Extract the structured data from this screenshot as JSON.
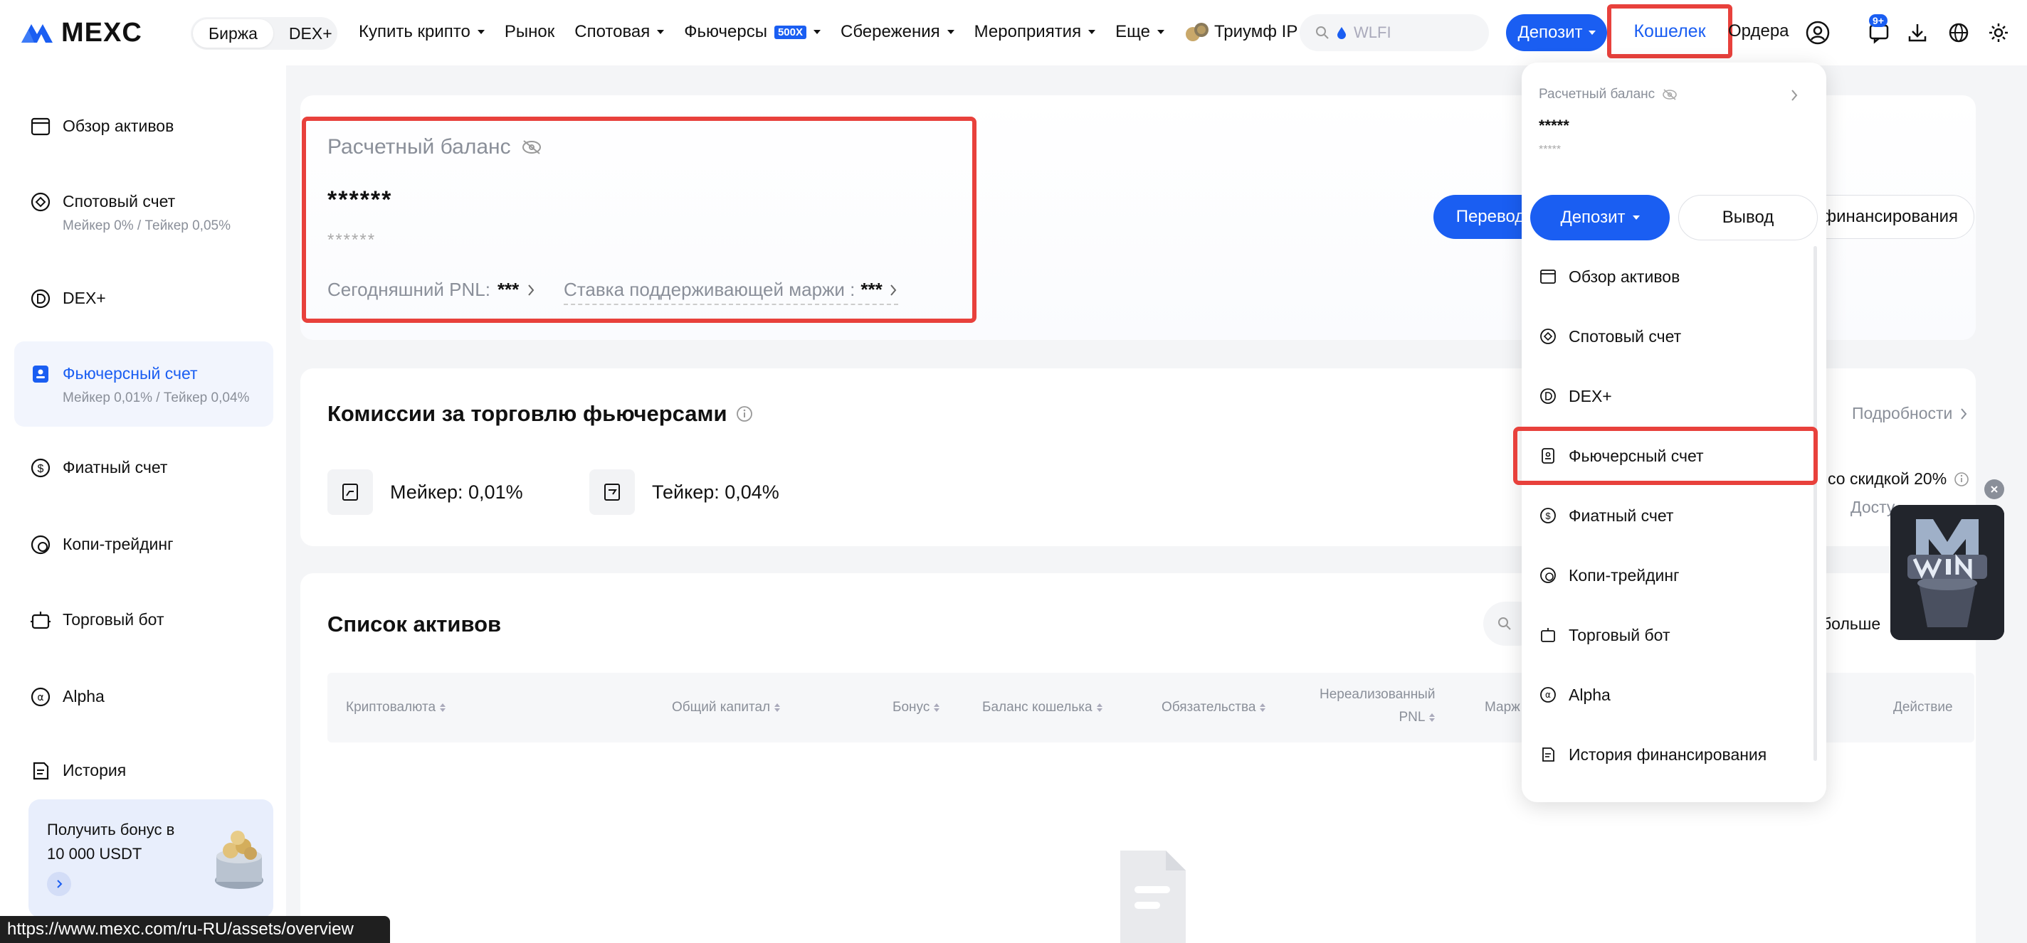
{
  "header": {
    "logo": "MEXC",
    "segment": [
      "Биржа",
      "DEX+"
    ],
    "nav": [
      {
        "label": "Купить крипто",
        "caret": true
      },
      {
        "label": "Рынок",
        "caret": false
      },
      {
        "label": "Спотовая",
        "caret": true
      },
      {
        "label": "Фьючерсы",
        "caret": true,
        "badge": "500X"
      },
      {
        "label": "Сбережения",
        "caret": true
      },
      {
        "label": "Мероприятия",
        "caret": true
      },
      {
        "label": "Еще",
        "caret": true
      },
      {
        "label": "Триумф IP",
        "caret": false
      }
    ],
    "search_placeholder": "WLFI",
    "deposit": "Депозит",
    "wallet": "Кошелек",
    "orders": "Ордера",
    "notif_badge": "9+"
  },
  "sidebar": {
    "items": [
      {
        "label": "Обзор активов"
      },
      {
        "label": "Спотовый счет",
        "sub": "Мейкер 0% / Тейкер 0,05%"
      },
      {
        "label": "DEX+"
      },
      {
        "label": "Фьючерсный счет",
        "sub": "Мейкер 0,01% / Тейкер 0,04%"
      },
      {
        "label": "Фиатный счет"
      },
      {
        "label": "Копи-трейдинг"
      },
      {
        "label": "Торговый бот"
      },
      {
        "label": "Alpha"
      },
      {
        "label": "История"
      }
    ],
    "bonus": "Получить бонус в 10 000 USDT"
  },
  "balance": {
    "title": "Расчетный баланс",
    "value": "******",
    "sub_value": "******",
    "pnl_label": "Сегодняшний PNL:",
    "pnl_value": "***",
    "margin_label": "Ставка поддерживающей маржи :",
    "margin_value": "***",
    "transfer": "Перевод",
    "funding": "финансирования"
  },
  "fees": {
    "title": "Комиссии за торговлю фьючерсами",
    "maker": "Мейкер: 0,01%",
    "taker": "Тейкер: 0,04%",
    "details": "Подробности",
    "discount": "со скидкой 20%",
    "available": "Досту"
  },
  "assets": {
    "title": "Список активов",
    "more": "больше",
    "columns": [
      "Криптовалюта",
      "Общий капитал",
      "Бонус",
      "Баланс кошелька",
      "Обязательства",
      "Нереализованный",
      "PNL",
      "Марж",
      "Действие"
    ]
  },
  "dropdown": {
    "title": "Расчетный баланс",
    "value": "*****",
    "sub_value": "*****",
    "deposit": "Депозит",
    "withdraw": "Вывод",
    "items": [
      {
        "label": "Обзор активов",
        "icon": "wallet-icon"
      },
      {
        "label": "Спотовый счет",
        "icon": "spot-icon"
      },
      {
        "label": "DEX+",
        "icon": "dex-icon"
      },
      {
        "label": "Фьючерсный счет",
        "icon": "futures-icon"
      },
      {
        "label": "Фиатный счет",
        "icon": "dollar-icon"
      },
      {
        "label": "Копи-трейдинг",
        "icon": "copy-icon"
      },
      {
        "label": "Торговый бот",
        "icon": "bot-icon"
      },
      {
        "label": "Alpha",
        "icon": "alpha-icon"
      },
      {
        "label": "История финансирования",
        "icon": "history-icon"
      }
    ]
  },
  "status_url": "https://www.mexc.com/ru-RU/assets/overview",
  "colors": {
    "accent": "#1a5ef2",
    "highlight": "#e8413c"
  }
}
